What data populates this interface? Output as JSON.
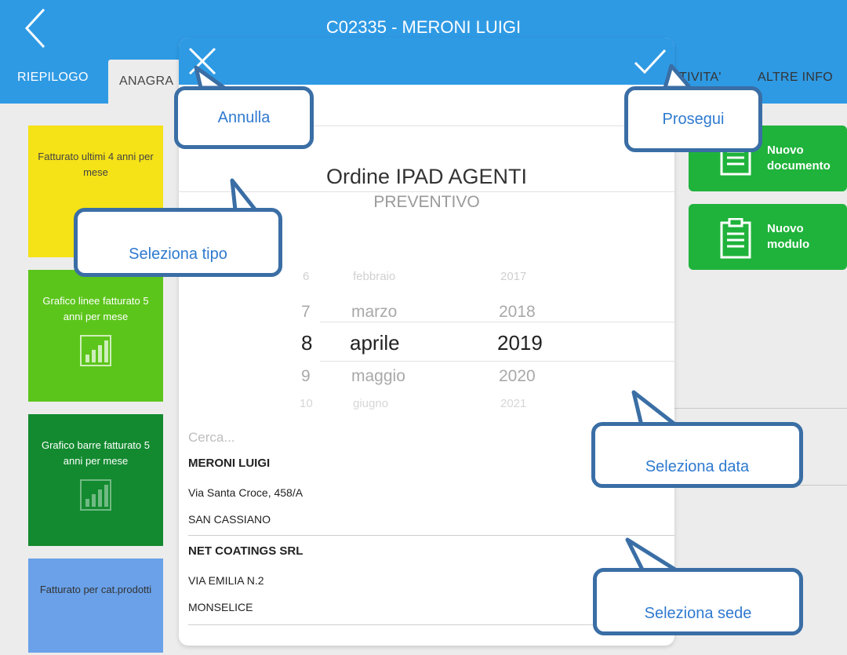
{
  "header": {
    "title": "C02335 - MERONI LUIGI"
  },
  "tabs": [
    {
      "label": "RIEPILOGO"
    },
    {
      "label": "ANAGRA"
    },
    {
      "label": "TIVITA'"
    },
    {
      "label": "ALTRE INFO"
    }
  ],
  "tiles": [
    {
      "label": "Fatturato ultimi 4 anni per mese",
      "color": "#f5e217"
    },
    {
      "label": "Grafico linee fatturato 5 anni per mese",
      "color": "#5cc51b"
    },
    {
      "label": "Grafico barre fatturato 5 anni per mese",
      "color": "#138a30"
    },
    {
      "label": "Fatturato per cat.prodotti",
      "color": "#6aa1e9"
    }
  ],
  "actions": {
    "new_document": "Nuovo documento",
    "new_module": "Nuovo modulo"
  },
  "modal": {
    "type_selected": "Ordine IPAD AGENTI",
    "type_next": "PREVENTIVO",
    "date_picker": {
      "rows": [
        {
          "day": "6",
          "month": "febbraio",
          "year": "2017"
        },
        {
          "day": "7",
          "month": "marzo",
          "year": "2018"
        },
        {
          "day": "8",
          "month": "aprile",
          "year": "2019"
        },
        {
          "day": "9",
          "month": "maggio",
          "year": "2020"
        },
        {
          "day": "10",
          "month": "giugno",
          "year": "2021"
        }
      ]
    },
    "search_placeholder": "Cerca...",
    "sites": [
      {
        "name": "MERONI LUIGI",
        "street": "Via Santa Croce, 458/A",
        "city": "SAN CASSIANO"
      },
      {
        "name": "NET COATINGS  SRL",
        "street": "VIA EMILIA N.2",
        "city": "MONSELICE"
      }
    ]
  },
  "callouts": {
    "cancel": "Annulla",
    "proceed": "Prosegui",
    "select_type": "Seleziona tipo",
    "select_date": "Seleziona data",
    "select_site": "Seleziona sede"
  },
  "colors": {
    "header_blue": "#2f9ae4",
    "green_button": "#1fb33b",
    "callout_border": "#3a6ea5",
    "callout_text": "#2f7ad0"
  }
}
